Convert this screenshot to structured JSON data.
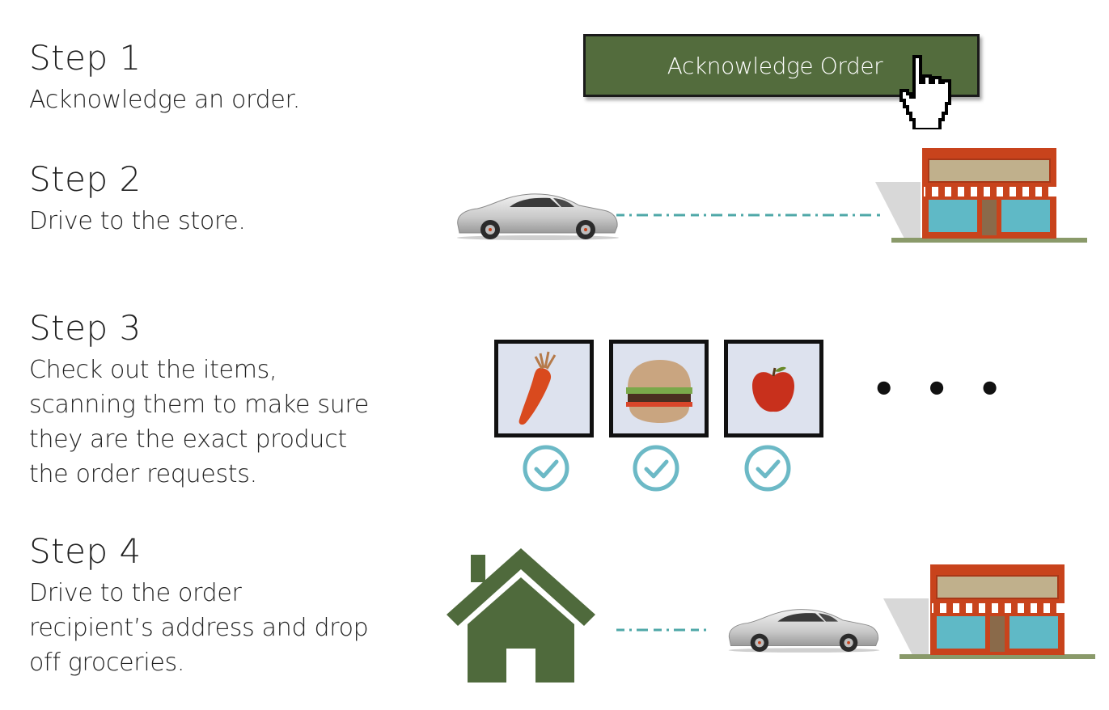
{
  "steps": [
    {
      "title": "Step 1",
      "desc": "Acknowledge an order."
    },
    {
      "title": "Step 2",
      "desc": "Drive to the store."
    },
    {
      "title": "Step 3",
      "desc": "Check out the items, scanning them to make sure they are the exact product the order requests."
    },
    {
      "title": "Step 4",
      "desc": "Drive to the order recipient’s address and drop off groceries."
    }
  ],
  "button": {
    "label": "Acknowledge Order"
  },
  "items": [
    {
      "name": "carrot-icon",
      "checked": true
    },
    {
      "name": "burger-icon",
      "checked": true
    },
    {
      "name": "apple-icon",
      "checked": true
    }
  ],
  "more_indicator": "• • •",
  "colors": {
    "button_green": "#536c3d",
    "house_green": "#4f6a3c",
    "store_red": "#c8431c",
    "store_window": "#5fb9c6",
    "check_teal": "#6cb9c6",
    "tile_bg": "#dde2ee"
  }
}
